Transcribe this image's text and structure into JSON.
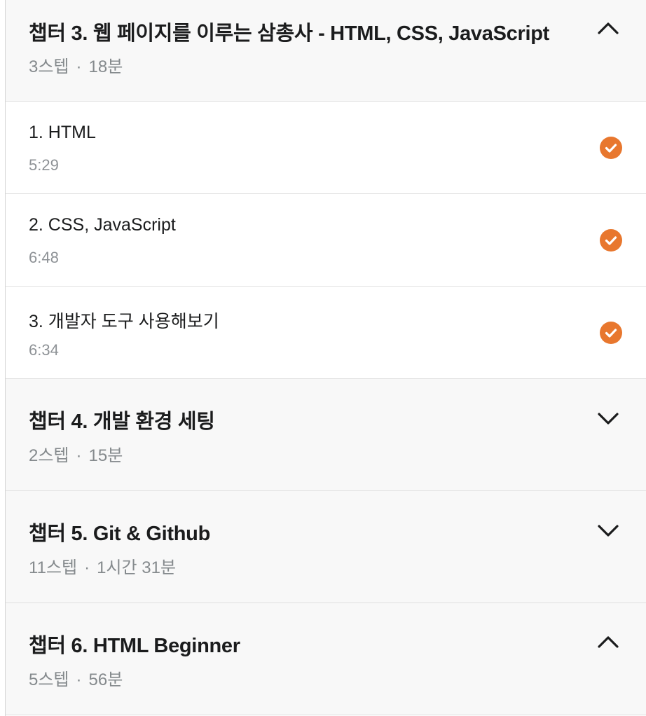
{
  "chapters": [
    {
      "title": "챕터 3. 웹 페이지를 이루는 삼총사 - HTML, CSS, JavaScript",
      "steps": "3스텝",
      "dot": "·",
      "duration": "18분",
      "expanded": true,
      "units": [
        {
          "title": "1. HTML",
          "duration": "5:29",
          "completed": true
        },
        {
          "title": "2. CSS, JavaScript",
          "duration": "6:48",
          "completed": true
        },
        {
          "title": "3. 개발자 도구 사용해보기",
          "duration": "6:34",
          "completed": true
        }
      ]
    },
    {
      "title": "챕터 4. 개발 환경 세팅",
      "steps": "2스텝",
      "dot": "·",
      "duration": "15분",
      "expanded": false
    },
    {
      "title": "챕터 5. Git & Github",
      "steps": "11스텝",
      "dot": "·",
      "duration": "1시간 31분",
      "expanded": false
    },
    {
      "title": "챕터 6. HTML Beginner",
      "steps": "5스텝",
      "dot": "·",
      "duration": "56분",
      "expanded": true
    }
  ],
  "colors": {
    "accent": "#e8772e",
    "header_bg": "#f8f8f8",
    "divider": "#e0e0e0",
    "meta_text": "#858a8d"
  },
  "icons": {
    "collapse": "chevron-up-icon",
    "expand": "chevron-down-icon",
    "completed": "check-circle-icon"
  }
}
